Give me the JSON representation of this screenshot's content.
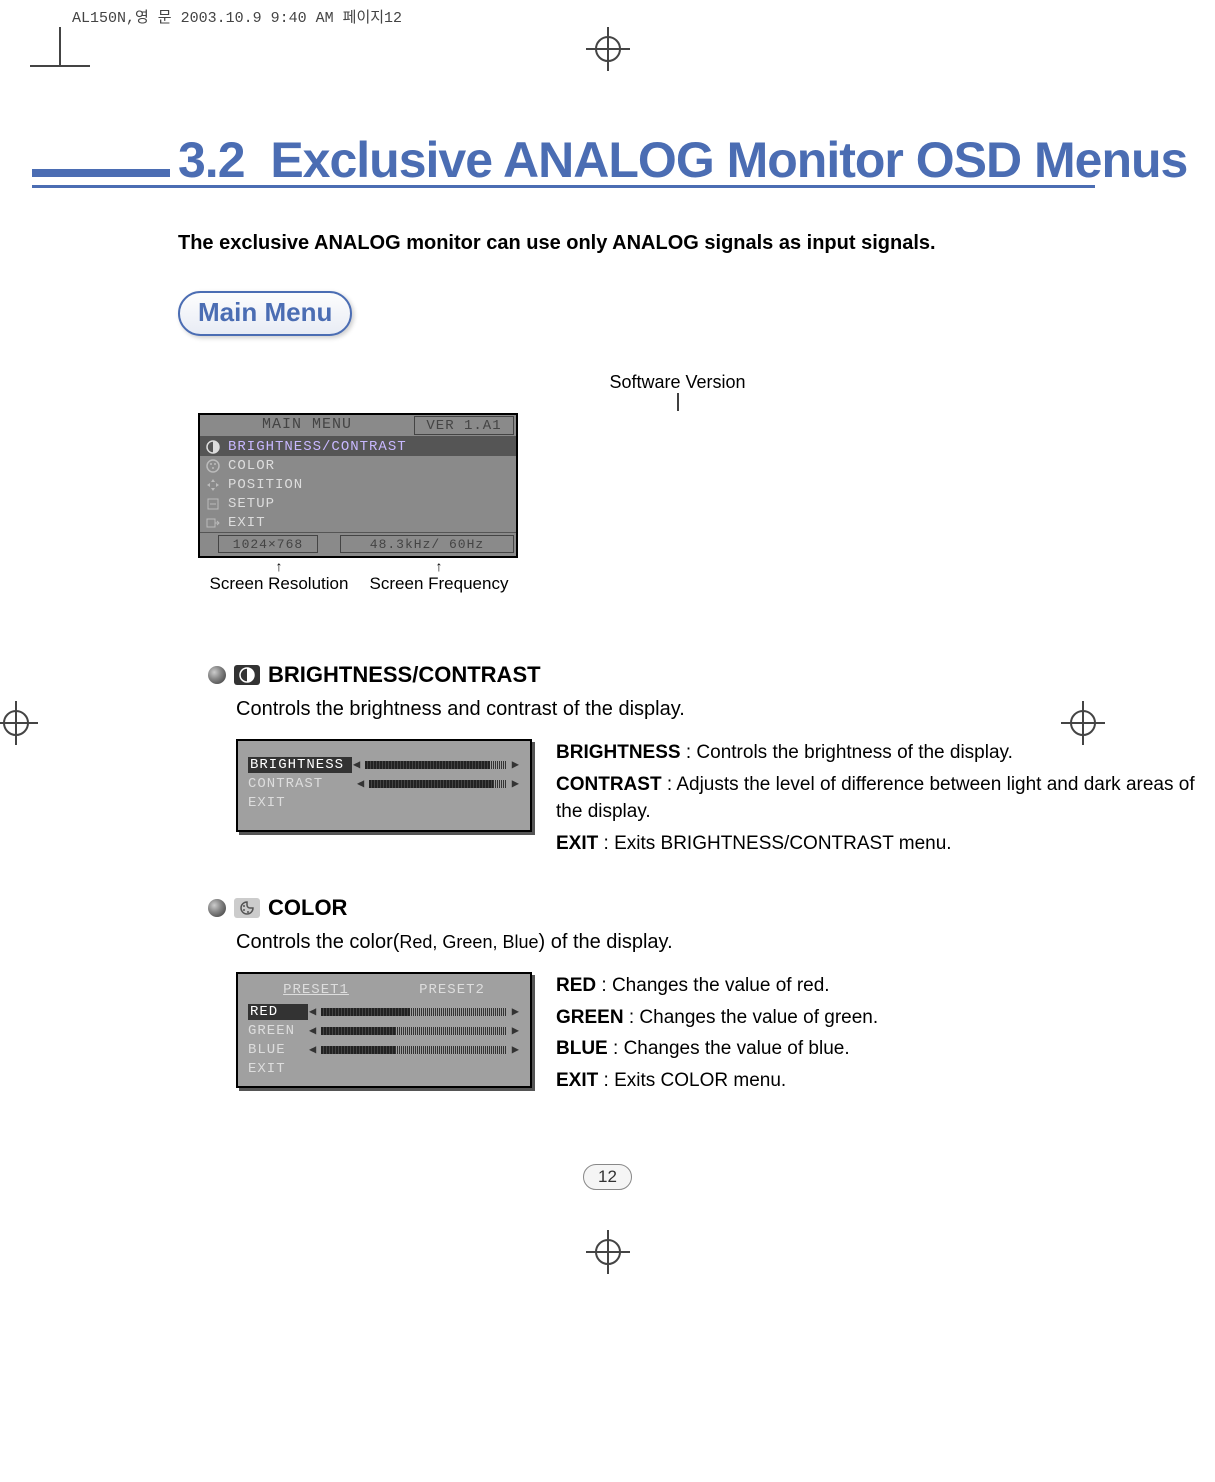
{
  "print_header": "AL150N,영 문  2003.10.9 9:40 AM  페이지12",
  "section": {
    "number": "3.2",
    "title": "Exclusive ANALOG Monitor OSD Menus"
  },
  "intro": "The exclusive ANALOG monitor can use only ANALOG signals as input signals.",
  "pill": "Main Menu",
  "labels": {
    "software_version": "Software Version",
    "screen_resolution": "Screen Resolution",
    "screen_frequency": "Screen Frequency"
  },
  "osd_main": {
    "header": "MAIN MENU",
    "version": "VER 1.A1",
    "items": [
      "BRIGHTNESS/CONTRAST",
      "COLOR",
      "POSITION",
      "SETUP",
      "EXIT"
    ],
    "resolution": "1024×768",
    "frequency": "48.3kHz/  60Hz"
  },
  "brightness_section": {
    "heading": "BRIGHTNESS/CONTRAST",
    "desc": "Controls the brightness and contrast of the display.",
    "menu": {
      "items": [
        "BRIGHTNESS",
        "CONTRAST",
        "EXIT"
      ],
      "fills": [
        88,
        90
      ]
    },
    "definitions": [
      {
        "term": "BRIGHTNESS",
        "text": " : Controls the brightness of the display."
      },
      {
        "term": "CONTRAST",
        "text": " : Adjusts the level of difference between light and dark areas of the display."
      },
      {
        "term": "EXIT",
        "text": " : Exits BRIGHTNESS/CONTRAST menu."
      }
    ]
  },
  "color_section": {
    "heading": "COLOR",
    "desc_prefix": "Controls the color(",
    "desc_small": "Red, Green, Blue",
    "desc_suffix": ") of the display.",
    "presets": [
      "PRESET1",
      "PRESET2"
    ],
    "menu": {
      "items": [
        "RED",
        "GREEN",
        "BLUE",
        "EXIT"
      ],
      "fills": [
        48,
        40,
        40
      ]
    },
    "definitions": [
      {
        "term": "RED",
        "text": " : Changes the value of red."
      },
      {
        "term": "GREEN",
        "text": " : Changes the value of green."
      },
      {
        "term": "BLUE",
        "text": " : Changes the value of blue."
      },
      {
        "term": "EXIT",
        "text": " : Exits COLOR menu."
      }
    ]
  },
  "page_number": "12"
}
